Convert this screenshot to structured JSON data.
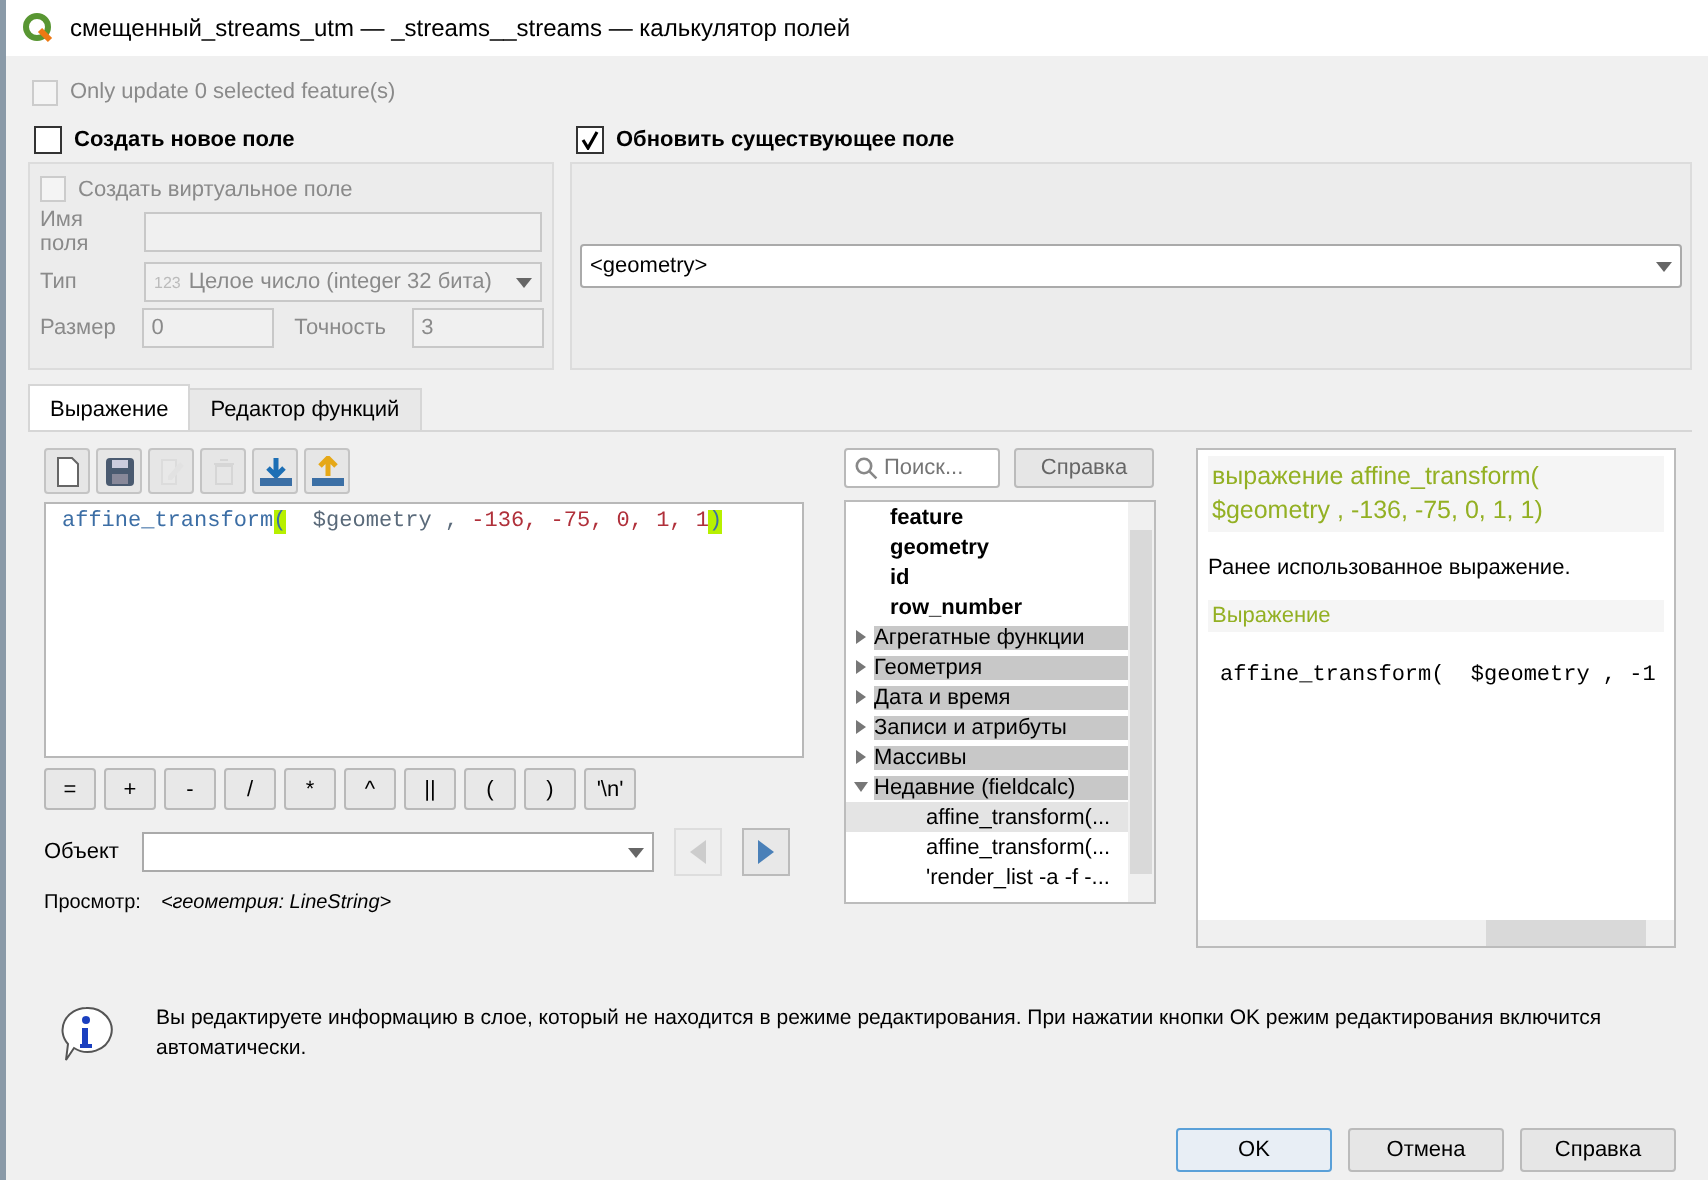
{
  "window": {
    "title": "смещенный_streams_utm — _streams__streams — калькулятор полей"
  },
  "only_selected": {
    "label": "Only update 0 selected feature(s)",
    "checked": false,
    "disabled": true
  },
  "new_field": {
    "label": "Создать новое поле",
    "checked": false,
    "virtual": {
      "label": "Создать виртуальное поле",
      "checked": false
    },
    "name_label": "Имя поля",
    "type_label": "Тип",
    "type_value": "Целое число (integer 32 бита)",
    "type_badge": "123",
    "size_label": "Размер",
    "size_value": "0",
    "precision_label": "Точность",
    "precision_value": "3"
  },
  "update_field": {
    "label": "Обновить существующее поле",
    "checked": true,
    "value": "<geometry>"
  },
  "tabs": [
    {
      "label": "Выражение",
      "selected": true
    },
    {
      "label": "Редактор функций",
      "selected": false
    }
  ],
  "toolbar": [
    {
      "kind": "new",
      "disabled": false
    },
    {
      "kind": "save",
      "disabled": false
    },
    {
      "kind": "edit",
      "disabled": true
    },
    {
      "kind": "delete",
      "disabled": true
    },
    {
      "kind": "import",
      "disabled": false
    },
    {
      "kind": "export",
      "disabled": false
    }
  ],
  "expression": [
    {
      "text": "affine_transform",
      "kind": "func",
      "highlight": false
    },
    {
      "text": "(",
      "kind": "punct",
      "highlight": true
    },
    {
      "text": "  $geometry , ",
      "kind": "field",
      "highlight": false
    },
    {
      "text": "-136, -75, 0, 1, 1",
      "kind": "num",
      "highlight": false
    },
    {
      "text": ")",
      "kind": "punct",
      "highlight": true
    }
  ],
  "operators": [
    "=",
    "+",
    "-",
    "/",
    "*",
    "^",
    "||",
    "(",
    ")",
    "'\\n'"
  ],
  "feature": {
    "label": "Объект"
  },
  "preview": {
    "label": "Просмотр:",
    "value": "<геометрия: LineString>"
  },
  "search": {
    "placeholder": "Поиск..."
  },
  "help_button": "Справка",
  "tree": [
    {
      "label": "feature",
      "kind": "field",
      "selected": false
    },
    {
      "label": "geometry",
      "kind": "field",
      "selected": false
    },
    {
      "label": "id",
      "kind": "field",
      "selected": false
    },
    {
      "label": "row_number",
      "kind": "field",
      "selected": false
    },
    {
      "label": "Агрегатные функции",
      "kind": "group",
      "expanded": false,
      "selected": false
    },
    {
      "label": "Геометрия",
      "kind": "group",
      "expanded": false,
      "selected": false
    },
    {
      "label": "Дата и время",
      "kind": "group",
      "expanded": false,
      "selected": false
    },
    {
      "label": "Записи и атрибуты",
      "kind": "group",
      "expanded": false,
      "selected": false
    },
    {
      "label": "Массивы",
      "kind": "group",
      "expanded": false,
      "selected": false
    },
    {
      "label": "Недавние (fieldcalc)",
      "kind": "group",
      "expanded": true,
      "selected": false,
      "children": [
        {
          "label": "affine_transform(...",
          "kind": "item",
          "selected": true
        },
        {
          "label": "affine_transform(...",
          "kind": "item",
          "selected": false
        },
        {
          "label": "'render_list -a -f -...",
          "kind": "item",
          "selected": false
        }
      ]
    }
  ],
  "help": {
    "title": "выражение affine_transform( $geometry , -136, -75, 0, 1, 1)",
    "text": "Ранее использованное выражение.",
    "section": "Выражение",
    "code": "affine_transform(  $geometry , -1"
  },
  "message": "Вы редактируете информацию в слое, который не находится в режиме редактирования. При нажатии кнопки OK режим редактирования включится автоматически.",
  "buttons": [
    {
      "label": "OK",
      "kind": "default"
    },
    {
      "label": "Отмена",
      "kind": "normal"
    },
    {
      "label": "Справка",
      "kind": "normal"
    }
  ]
}
